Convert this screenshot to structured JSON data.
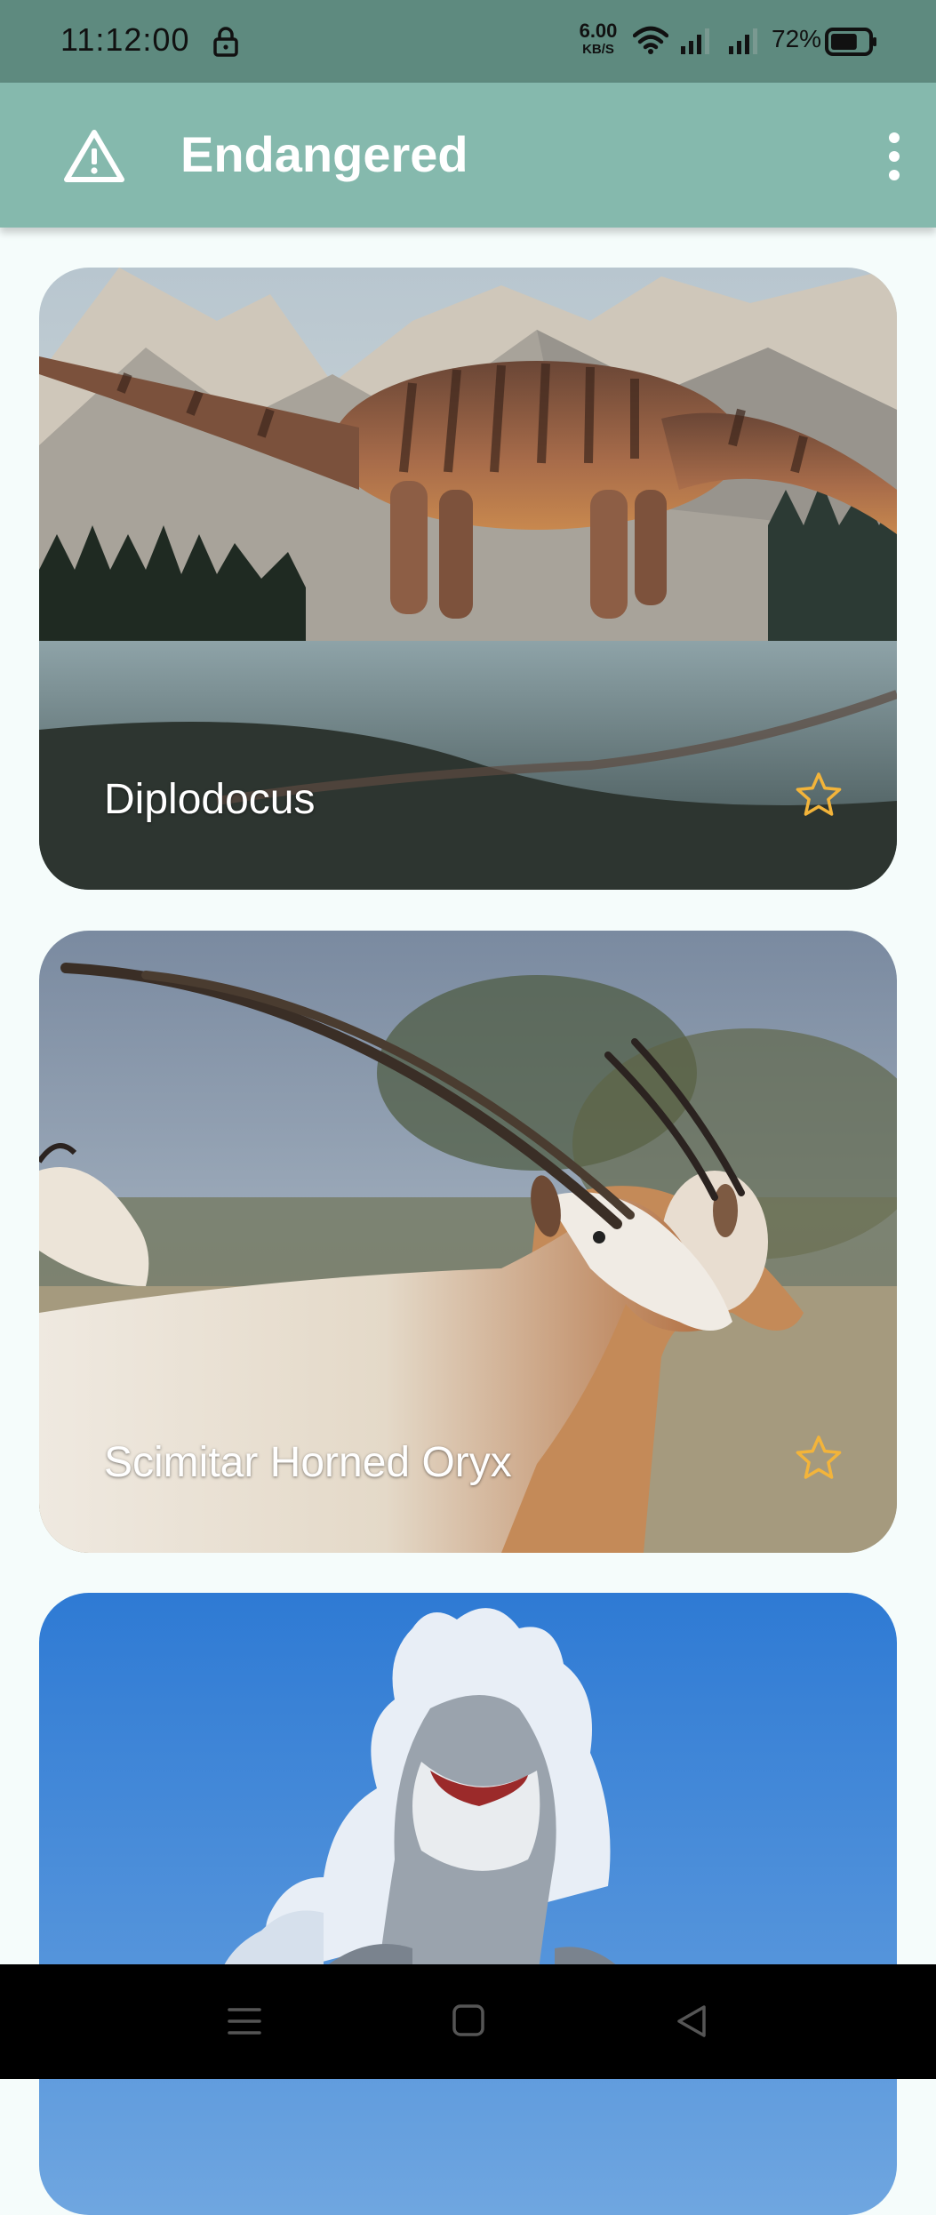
{
  "status_bar": {
    "time": "11:12:00",
    "net_speed_value": "6.00",
    "net_speed_unit": "KB/S",
    "battery": "72%",
    "battery_level": 0.72,
    "icons": [
      "lock-icon",
      "wifi-icon",
      "signal-icon",
      "signal-icon",
      "battery-icon"
    ]
  },
  "app_bar": {
    "title": "Endangered",
    "leading_icon": "warning-icon",
    "overflow_icon": "more-vert-icon",
    "background": "#85b9ad"
  },
  "cards": [
    {
      "label": "Diplodocus",
      "favorite_icon": "star-outline-icon"
    },
    {
      "label": "Scimitar Horned Oryx",
      "favorite_icon": "star-outline-icon"
    },
    {
      "label": ""
    }
  ],
  "colors": {
    "star": "#f3b43a",
    "status_bar": "#5e8a7f",
    "background": "#f5fcfb"
  },
  "nav_bar": {
    "icons": [
      "menu-icon",
      "home-icon",
      "back-icon"
    ]
  }
}
